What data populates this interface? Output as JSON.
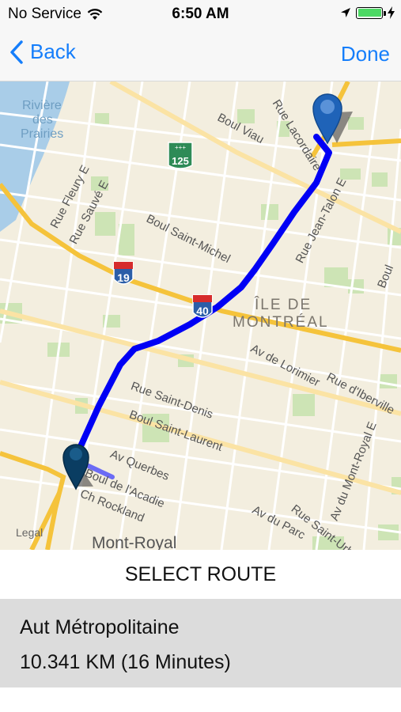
{
  "status_bar": {
    "carrier": "No Service",
    "time": "6:50 AM",
    "battery_level": 1.0,
    "icons": [
      "wifi-icon",
      "location-arrow-icon",
      "battery-icon",
      "charging-bolt-icon"
    ]
  },
  "nav": {
    "back_label": "Back",
    "done_label": "Done"
  },
  "map": {
    "water_labels": [
      "Rivière",
      "des",
      "Prairies"
    ],
    "district_labels": [
      "ÎLE DE",
      "MONTRÉAL"
    ],
    "bottom_area_label": "Mont-Royal",
    "streets": [
      "Boul Viau",
      "Rue Lacordaire",
      "Rue Fleury E",
      "Rue Sauvé E",
      "Boul Saint-Michel",
      "Rue Jean-Talon E",
      "Av de Lorimier",
      "Rue d'Iberville",
      "Rue Saint-Denis",
      "Boul Saint-Laurent",
      "Av Querbes",
      "Boul de l'Acadie",
      "Ch Rockland",
      "Av du Parc",
      "Rue Saint-Urbain",
      "Av du Mont-Royal E",
      "Boul"
    ],
    "shields": [
      "125",
      "19",
      "40"
    ],
    "legal_label": "Legal",
    "colors": {
      "route": "#0000f5",
      "pin": "#0a3d62",
      "highway": "#f5c33b",
      "water": "#a9cde8",
      "park": "#cde4b5"
    }
  },
  "route_selector": {
    "title": "SELECT ROUTE",
    "route_name": "Aut Métropolitaine",
    "route_summary": "10.341 KM (16 Minutes)"
  }
}
